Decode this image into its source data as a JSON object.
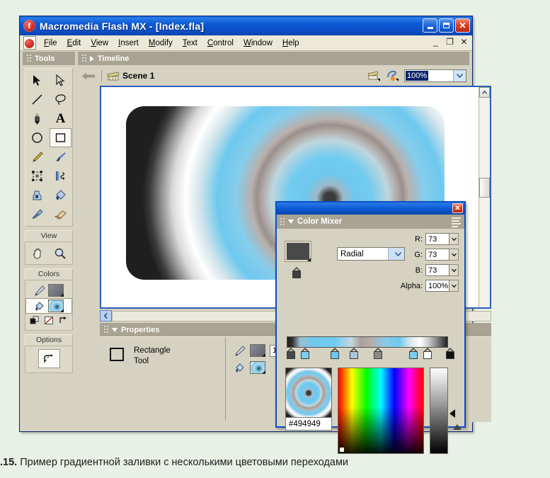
{
  "window": {
    "title": "Macromedia Flash MX - [Index.fla]",
    "app_icon": "flash-logo-icon",
    "buttons": {
      "minimize": "minimize-icon",
      "maximize": "maximize-icon",
      "close": "close-icon"
    },
    "mdi_buttons": {
      "minimize": "_",
      "restore": "❐",
      "close": "✕"
    }
  },
  "menubar": {
    "items": [
      {
        "label": "File",
        "accel": "F"
      },
      {
        "label": "Edit",
        "accel": "E"
      },
      {
        "label": "View",
        "accel": "V"
      },
      {
        "label": "Insert",
        "accel": "I"
      },
      {
        "label": "Modify",
        "accel": "M"
      },
      {
        "label": "Text",
        "accel": "T"
      },
      {
        "label": "Control",
        "accel": "C"
      },
      {
        "label": "Window",
        "accel": "W"
      },
      {
        "label": "Help",
        "accel": "H"
      }
    ]
  },
  "tools_panel": {
    "title": "Tools",
    "tools": [
      {
        "name": "arrow-tool",
        "selected": false
      },
      {
        "name": "subselection-tool",
        "selected": false
      },
      {
        "name": "line-tool",
        "selected": false
      },
      {
        "name": "lasso-tool",
        "selected": false
      },
      {
        "name": "pen-tool",
        "selected": false
      },
      {
        "name": "text-tool",
        "selected": false
      },
      {
        "name": "oval-tool",
        "selected": false
      },
      {
        "name": "rectangle-tool",
        "selected": true
      },
      {
        "name": "pencil-tool",
        "selected": false
      },
      {
        "name": "brush-tool",
        "selected": false
      },
      {
        "name": "free-transform-tool",
        "selected": false
      },
      {
        "name": "fill-transform-tool",
        "selected": false
      },
      {
        "name": "ink-bottle-tool",
        "selected": false
      },
      {
        "name": "paint-bucket-tool",
        "selected": false
      },
      {
        "name": "eyedropper-tool",
        "selected": false
      },
      {
        "name": "eraser-tool",
        "selected": false
      }
    ],
    "view_section": {
      "label": "View",
      "tools": [
        "hand-tool",
        "zoom-tool"
      ]
    },
    "colors_section": {
      "label": "Colors",
      "stroke_color": "#6e7078",
      "fill_gradient_preview": "radial-blue-gradient",
      "modifiers": [
        "black-and-white-icon",
        "no-color-icon",
        "swap-colors-icon"
      ]
    },
    "options_section": {
      "label": "Options",
      "tools": [
        "round-rectangle-radius-tool"
      ]
    }
  },
  "timeline": {
    "title": "Timeline",
    "collapsed": true
  },
  "scene_bar": {
    "back_arrow": "back-arrow-icon",
    "scene_name": "Scene 1",
    "scene_icon": "scene-clapper-icon",
    "edit_scene_icon": "edit-scene-icon",
    "edit_symbol_icon": "edit-symbol-icon",
    "zoom_value": "100%"
  },
  "stage": {
    "shape": "rounded-rectangle-with-radial-gradient",
    "gradient_type": "Radial"
  },
  "properties": {
    "title": "Properties",
    "tool_name_line1": "Rectangle",
    "tool_name_line2": "Tool",
    "stroke_color": "#6e7078",
    "stroke_width": "1",
    "fill_swatch": "radial-blue-gradient"
  },
  "color_mixer": {
    "title": "Color Mixer",
    "close_label": "✕",
    "options_menu_icon": "panel-options-icon",
    "fill_color": "#494949",
    "gradient_type": "Radial",
    "fields": [
      {
        "label": "R:",
        "value": "73"
      },
      {
        "label": "G:",
        "value": "73"
      },
      {
        "label": "B:",
        "value": "73"
      },
      {
        "label": "Alpha:",
        "value": "100%"
      }
    ],
    "hex_value": "#494949",
    "gradient_stops": [
      {
        "pos": 0,
        "color": "#494949"
      },
      {
        "pos": 8,
        "color": "#7ecdf0"
      },
      {
        "pos": 28,
        "color": "#6ec8ee"
      },
      {
        "pos": 40,
        "color": "#a9c7d6"
      },
      {
        "pos": 56,
        "color": "#8a8a8a"
      },
      {
        "pos": 78,
        "color": "#7ecdf0"
      },
      {
        "pos": 88,
        "color": "#ffffff"
      },
      {
        "pos": 100,
        "color": "#111111"
      }
    ],
    "preview": "radial-gradient-preview",
    "color_picker": "saturation-value-field",
    "luminance_bar": "luminance-slider"
  },
  "caption": {
    "number": ".15.",
    "text": "Пример градиентной заливки с несколькими цветовыми переходами"
  }
}
